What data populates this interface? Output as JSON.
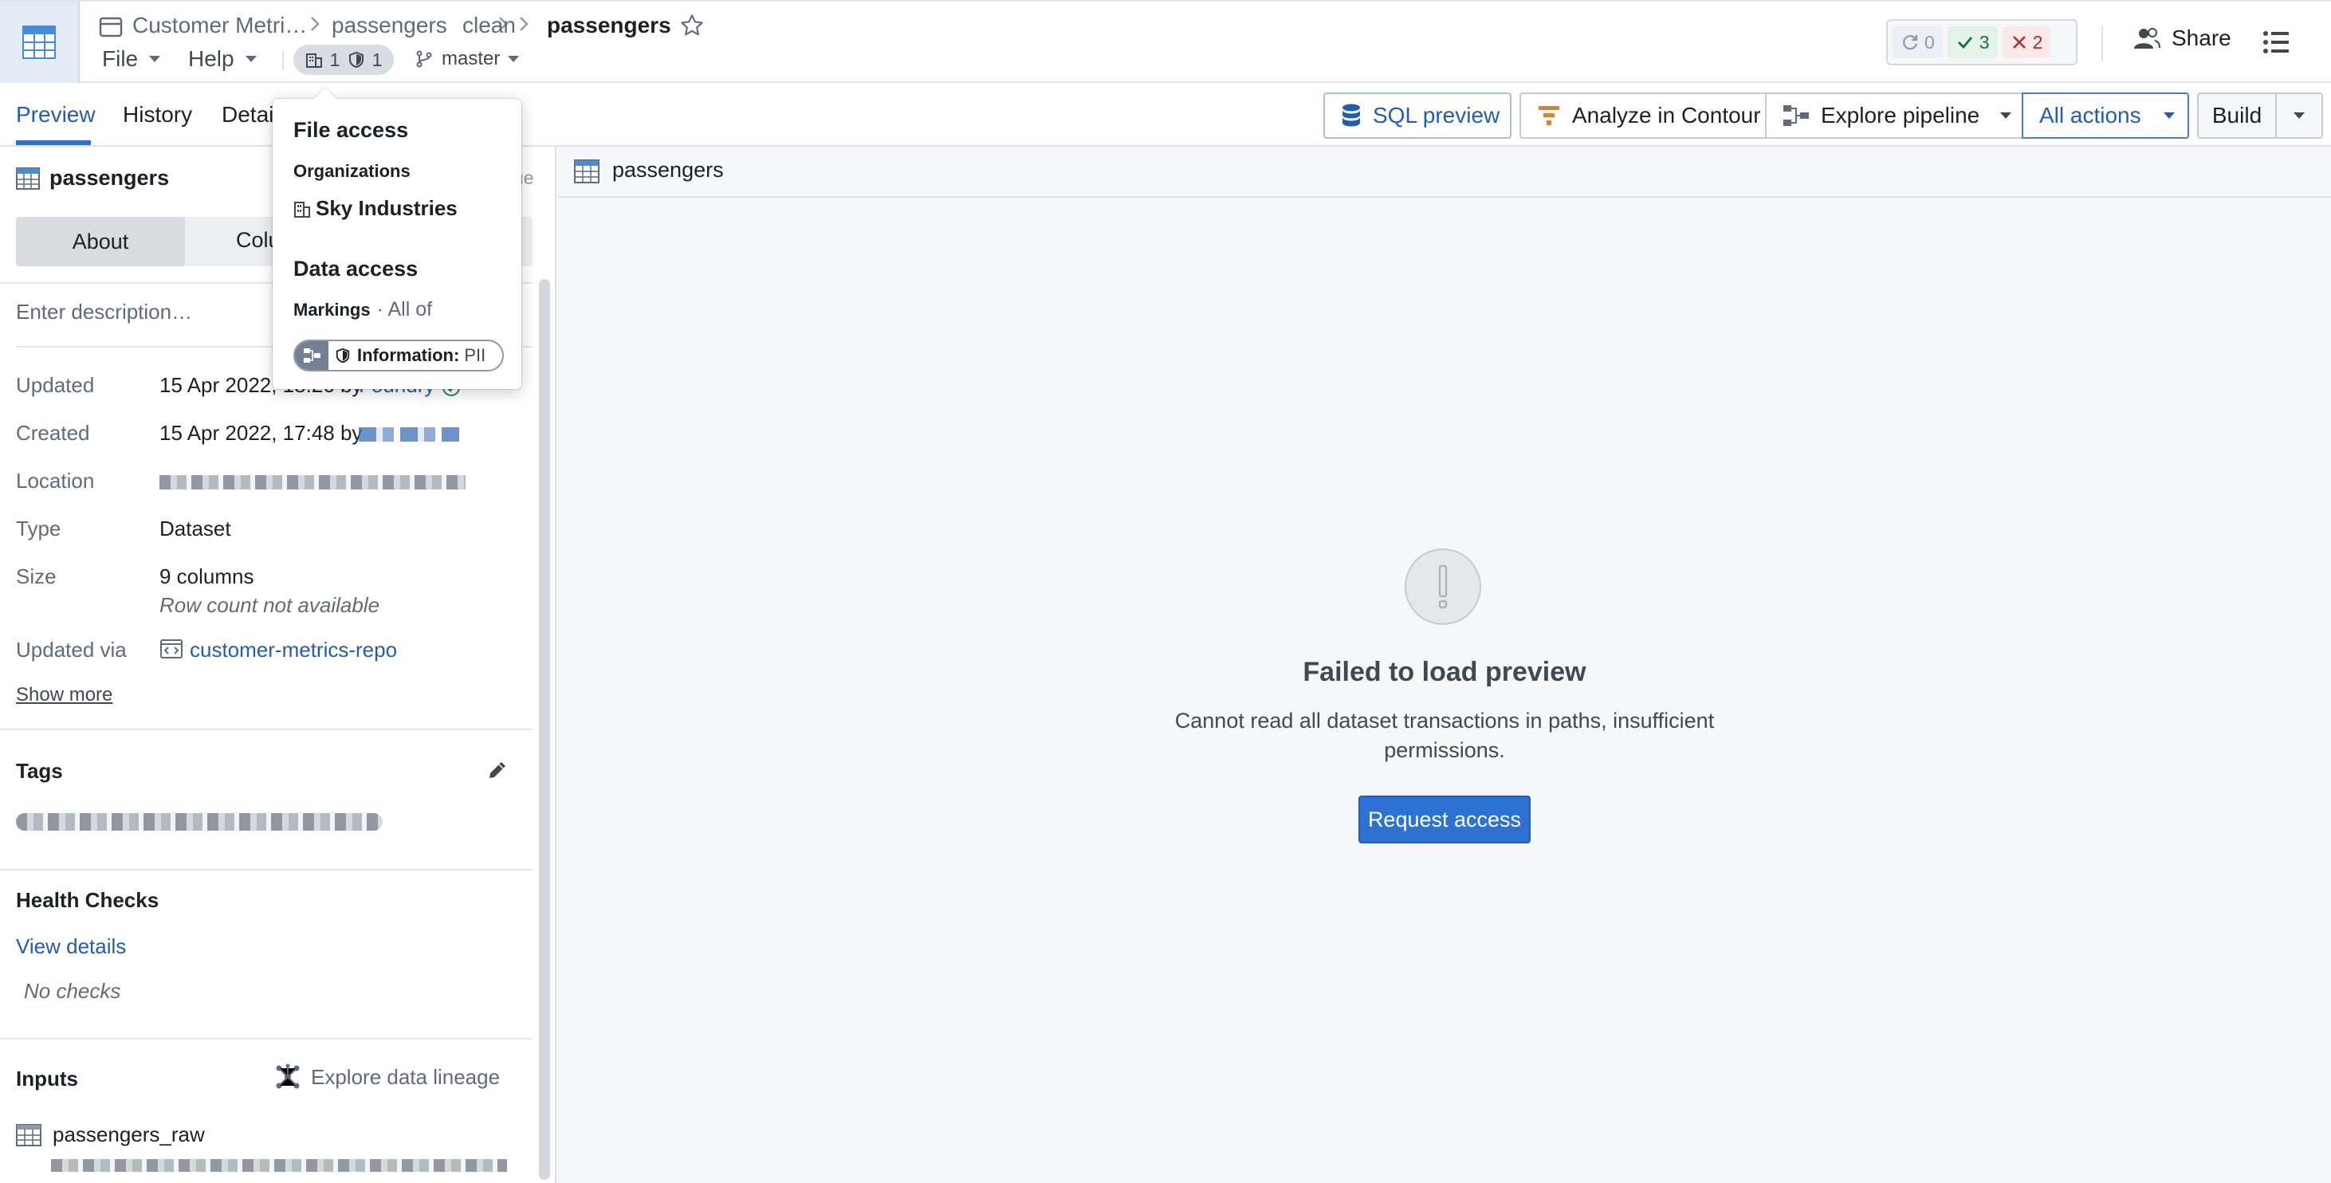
{
  "header": {
    "breadcrumb": [
      "Customer Metri…",
      "passengers",
      "clean"
    ],
    "title": "passengers",
    "menus": [
      "File",
      "Help"
    ],
    "access_counts": {
      "organizations": "1",
      "markings": "1"
    },
    "branch": "master",
    "checks": {
      "running": "0",
      "passed": "3",
      "failed": "2"
    },
    "share_label": "Share"
  },
  "tabs": [
    "Preview",
    "History",
    "Details"
  ],
  "toolbar": {
    "sql_preview": "SQL preview",
    "analyze": "Analyze in Contour",
    "explore_pipeline": "Explore pipeline",
    "all_actions": "All actions",
    "build": "Build"
  },
  "sidebar": {
    "dataset_name": "passengers",
    "issue_label": "ue",
    "segments": {
      "about": "About",
      "columns": "Colu"
    },
    "description_placeholder": "Enter description…",
    "rows": {
      "updated_label": "Updated",
      "updated_value": "15 Apr 2022, 18:26 by",
      "updated_by": "Foundry",
      "created_label": "Created",
      "created_value": "15 Apr 2022, 17:48 by",
      "location_label": "Location",
      "type_label": "Type",
      "type_value": "Dataset",
      "size_label": "Size",
      "size_value": "9 columns",
      "size_note": "Row count not available",
      "updated_via_label": "Updated via",
      "updated_via_value": "customer-metrics-repo"
    },
    "show_more": "Show more",
    "tags_title": "Tags",
    "health_title": "Health Checks",
    "health_link": "View details",
    "health_empty": "No checks",
    "inputs_title": "Inputs",
    "lineage_link": "Explore data lineage",
    "input_name": "passengers_raw"
  },
  "main": {
    "tab_title": "passengers",
    "error_title": "Failed to load preview",
    "error_message": "Cannot read all dataset transactions in paths, insufficient permissions.",
    "request_button": "Request access"
  },
  "popover": {
    "file_access": "File access",
    "organizations_label": "Organizations",
    "organization": "Sky Industries",
    "data_access": "Data access",
    "markings_label": "Markings",
    "markings_scope": "· All of",
    "marking_prefix": "Information:",
    "marking_value": "PII"
  },
  "colors": {
    "accent": "#2d72d2",
    "link": "#215db0",
    "success": "#1c6e42",
    "danger": "#ac2f33"
  }
}
